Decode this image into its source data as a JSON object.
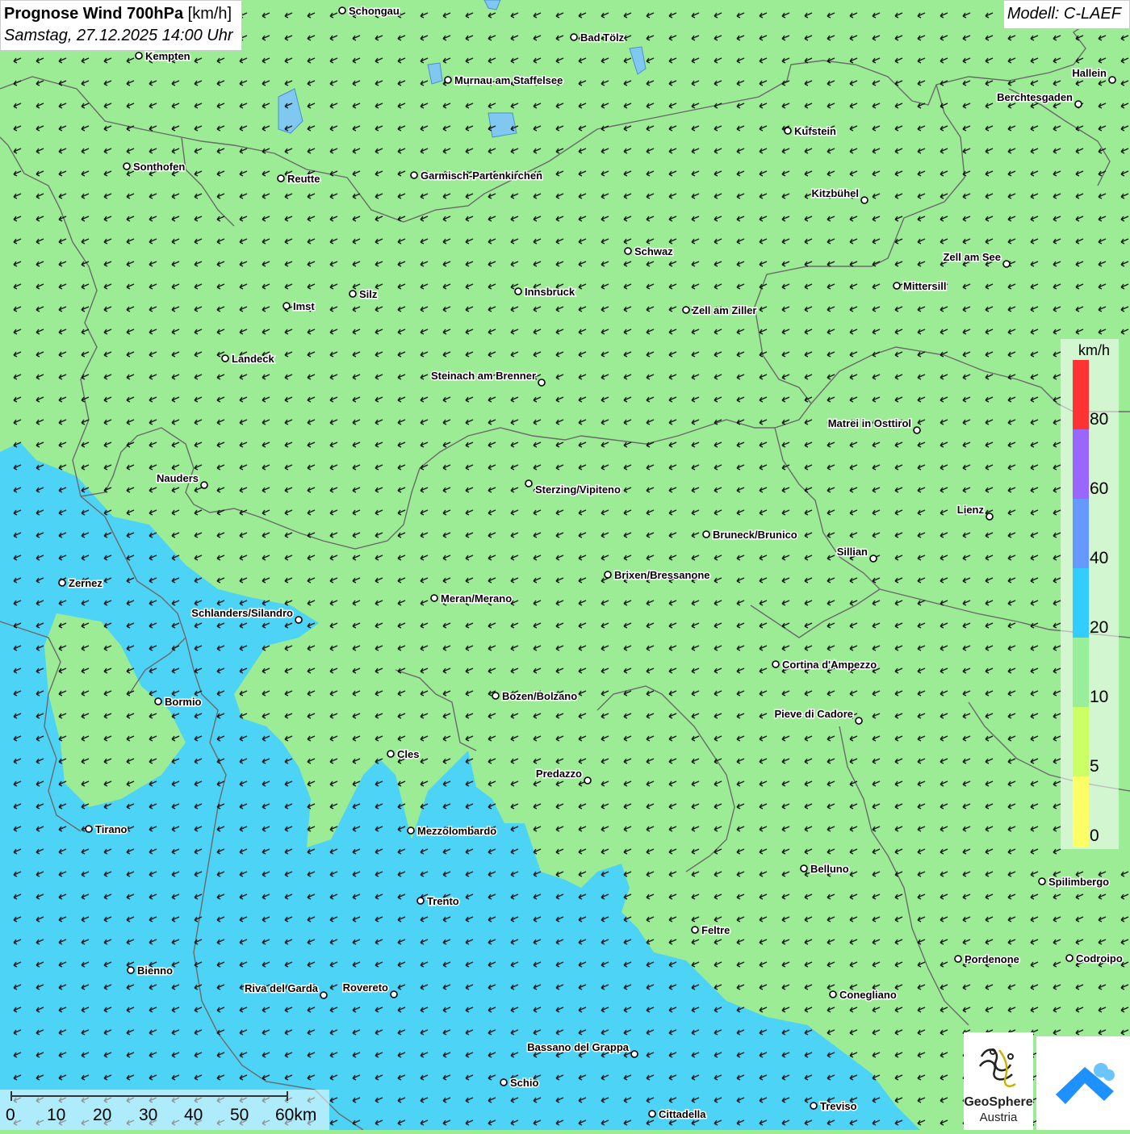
{
  "header": {
    "title_bold": "Prognose Wind 700hPa",
    "title_unit": "[km/h]",
    "datetime": "Samstag, 27.12.2025 14:00 Uhr",
    "model": "Modell: C-LAEF"
  },
  "legend": {
    "unit": "km/h",
    "ticks": [
      "80",
      "60",
      "40",
      "20",
      "10",
      "5",
      "0"
    ],
    "colors": {
      "0_5": "#ffff66",
      "5_10": "#ccff66",
      "10_20": "#99ee99",
      "20_40": "#33ccff",
      "40_60": "#6699ff",
      "60_80": "#9966ff",
      "80_plus": "#ff3333"
    }
  },
  "scale_bar": {
    "labels": [
      "0",
      "10",
      "20",
      "30",
      "40",
      "50",
      "60km"
    ]
  },
  "branding": {
    "name": "GeoSphere",
    "sub": "Austria"
  },
  "map": {
    "wind_direction": "from north-east",
    "colors": {
      "light_wind": "#9bec95",
      "moderate_wind": "#4dd3f5",
      "border": "#666666",
      "water": "#80c8f0"
    },
    "cities": [
      "Schongau",
      "Bad Tölz",
      "Kempten",
      "Murnau am Staffelsee",
      "Hallein",
      "Berchtesgaden",
      "Kufstein",
      "Sonthofen",
      "Reutte",
      "Garmisch-Partenkirchen",
      "Kitzbühel",
      "Schwaz",
      "Zell am See",
      "Mittersill",
      "Silz",
      "Innsbruck",
      "Imst",
      "Zell am Ziller",
      "Landeck",
      "Steinach am Brenner",
      "Matrei in Osttirol",
      "Nauders",
      "Sterzing/Vipiteno",
      "Lienz",
      "Bruneck/Brunico",
      "Sillian",
      "Zernez",
      "Brixen/Bressanone",
      "Meran/Merano",
      "Schlanders/Silandro",
      "Cortina d'Ampezzo",
      "Bozen/Bolzano",
      "Bormio",
      "Pieve di Cadore",
      "Cles",
      "Predazzo",
      "Tirano",
      "Mezzolombardo",
      "Belluno",
      "Spilimbergo",
      "Trento",
      "Feltre",
      "Bienno",
      "Pordenone",
      "Codroipo",
      "Riva del Garda",
      "Rovereto",
      "Conegliano",
      "Bassano del Grappa",
      "Schio",
      "Treviso",
      "Cittadella"
    ]
  }
}
